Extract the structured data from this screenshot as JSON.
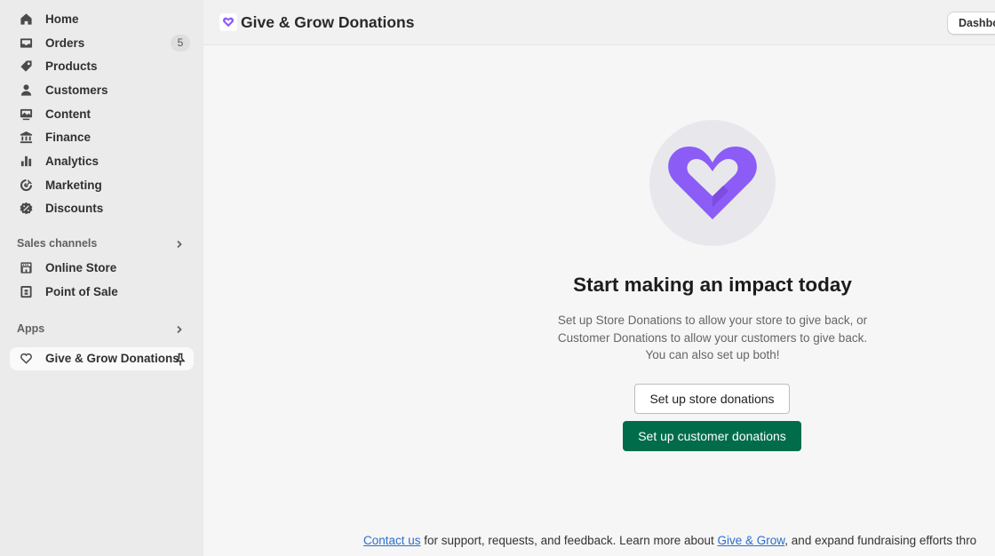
{
  "sidebar": {
    "items": [
      {
        "label": "Home",
        "icon": "home-icon"
      },
      {
        "label": "Orders",
        "icon": "inbox-icon",
        "badge": "5"
      },
      {
        "label": "Products",
        "icon": "tag-icon"
      },
      {
        "label": "Customers",
        "icon": "person-icon"
      },
      {
        "label": "Content",
        "icon": "image-icon"
      },
      {
        "label": "Finance",
        "icon": "bank-icon"
      },
      {
        "label": "Analytics",
        "icon": "bar-chart-icon"
      },
      {
        "label": "Marketing",
        "icon": "target-icon"
      },
      {
        "label": "Discounts",
        "icon": "discount-icon"
      }
    ],
    "sales_channels": {
      "header": "Sales channels",
      "items": [
        {
          "label": "Online Store",
          "icon": "store-icon"
        },
        {
          "label": "Point of Sale",
          "icon": "pos-icon"
        }
      ]
    },
    "apps": {
      "header": "Apps",
      "items": [
        {
          "label": "Give & Grow Donations",
          "icon": "heart-icon"
        }
      ]
    }
  },
  "topbar": {
    "title": "Give & Grow Donations",
    "dashboard_button": "Dashbo"
  },
  "main": {
    "headline": "Start making an impact today",
    "description_lines": [
      "Set up Store Donations to allow your store to give back, or",
      "Customer Donations to allow your customers to give back.",
      "You can also set up both!"
    ],
    "store_button": "Set up store donations",
    "customer_button": "Set up customer donations"
  },
  "footer": {
    "contact_link": "Contact us",
    "text_middle": " for support, requests, and feedback. Learn more about ",
    "brand_link": "Give & Grow",
    "text_end": ", and expand fundraising efforts thro"
  },
  "colors": {
    "accent_purple": "#8b5cf6",
    "primary_green": "#006c4a",
    "link_blue": "#2c6ecb"
  }
}
